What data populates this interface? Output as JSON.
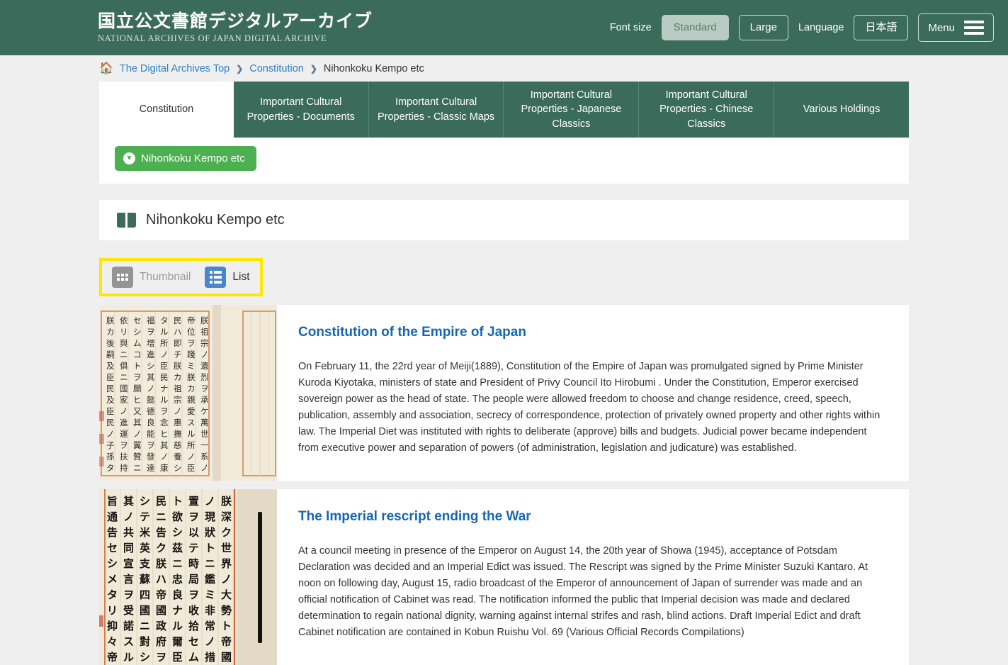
{
  "header": {
    "logo_jp": "国立公文書館デジタルアーカイブ",
    "logo_en": "NATIONAL ARCHIVES OF JAPAN  DIGITAL ARCHIVE",
    "font_size_label": "Font size",
    "font_size_standard": "Standard",
    "font_size_large": "Large",
    "language_label": "Language",
    "language_value": "日本語",
    "menu_label": "Menu",
    "bg_color": "#3b6b5b"
  },
  "breadcrumb": {
    "home": "The Digital Archives Top",
    "level2": "Constitution",
    "current": "Nihonkoku Kempo etc",
    "separator": "❯"
  },
  "tabs": [
    {
      "label": "Constitution",
      "active": true
    },
    {
      "label": "Important Cultural Properties - Documents",
      "active": false
    },
    {
      "label": "Important Cultural Properties - Classic Maps",
      "active": false
    },
    {
      "label": "Important Cultural Properties - Japanese Classics",
      "active": false
    },
    {
      "label": "Important Cultural Properties - Chinese Classics",
      "active": false
    },
    {
      "label": "Various Holdings",
      "active": false
    }
  ],
  "subbar": {
    "pill_label": "Nihonkoku Kempo etc",
    "pill_color": "#4caf50"
  },
  "section": {
    "title": "Nihonkoku Kempo etc",
    "icon": "open-book-icon"
  },
  "view_toggle": {
    "highlight_color": "#ffe600",
    "thumbnail_label": "Thumbnail",
    "list_label": "List",
    "thumbnail_active": true,
    "list_active": false
  },
  "items": [
    {
      "title": "Constitution of the Empire of Japan",
      "description": "On February 11, the 22rd year of Meiji(1889), Constitution of the Empire of Japan was promulgated signed by Prime Minister Kuroda Kiyotaka, ministers of state and President of Privy Council Ito Hirobumi . Under the Constitution, Emperor exercised sovereign power as the head of state. The people were allowed freedom to choose and change residence, creed, speech, publication, assembly and association, secrecy of correspondence, protection of privately owned property and other rights within law. The Imperial Diet was instituted with rights to deliberate (approve) bills and budgets. Judicial power became independent from executive power and separation of powers (of administration, legislation and judicature) was established."
    },
    {
      "title": "The Imperial rescript ending the War",
      "description": "At a council meeting in presence of the Emperor on August 14, the 20th year of Showa (1945), acceptance of Potsdam Declaration was decided and an Imperial Edict was issued. The Rescript was signed by the Prime Minister Suzuki Kantaro. At noon on following day, August 15, radio broadcast of the Emperor of announcement of Japan of surrender was made and an official notification of Cabinet was read. The notification informed the public that Imperial decision was made and declared determination to regain national dignity, warning against internal strifes and rash, blind actions. Draft Imperial Edict and draft Cabinet notification are contained in Kobun Ruishu Vol. 69 (Various Official Records Compilations)"
    }
  ]
}
